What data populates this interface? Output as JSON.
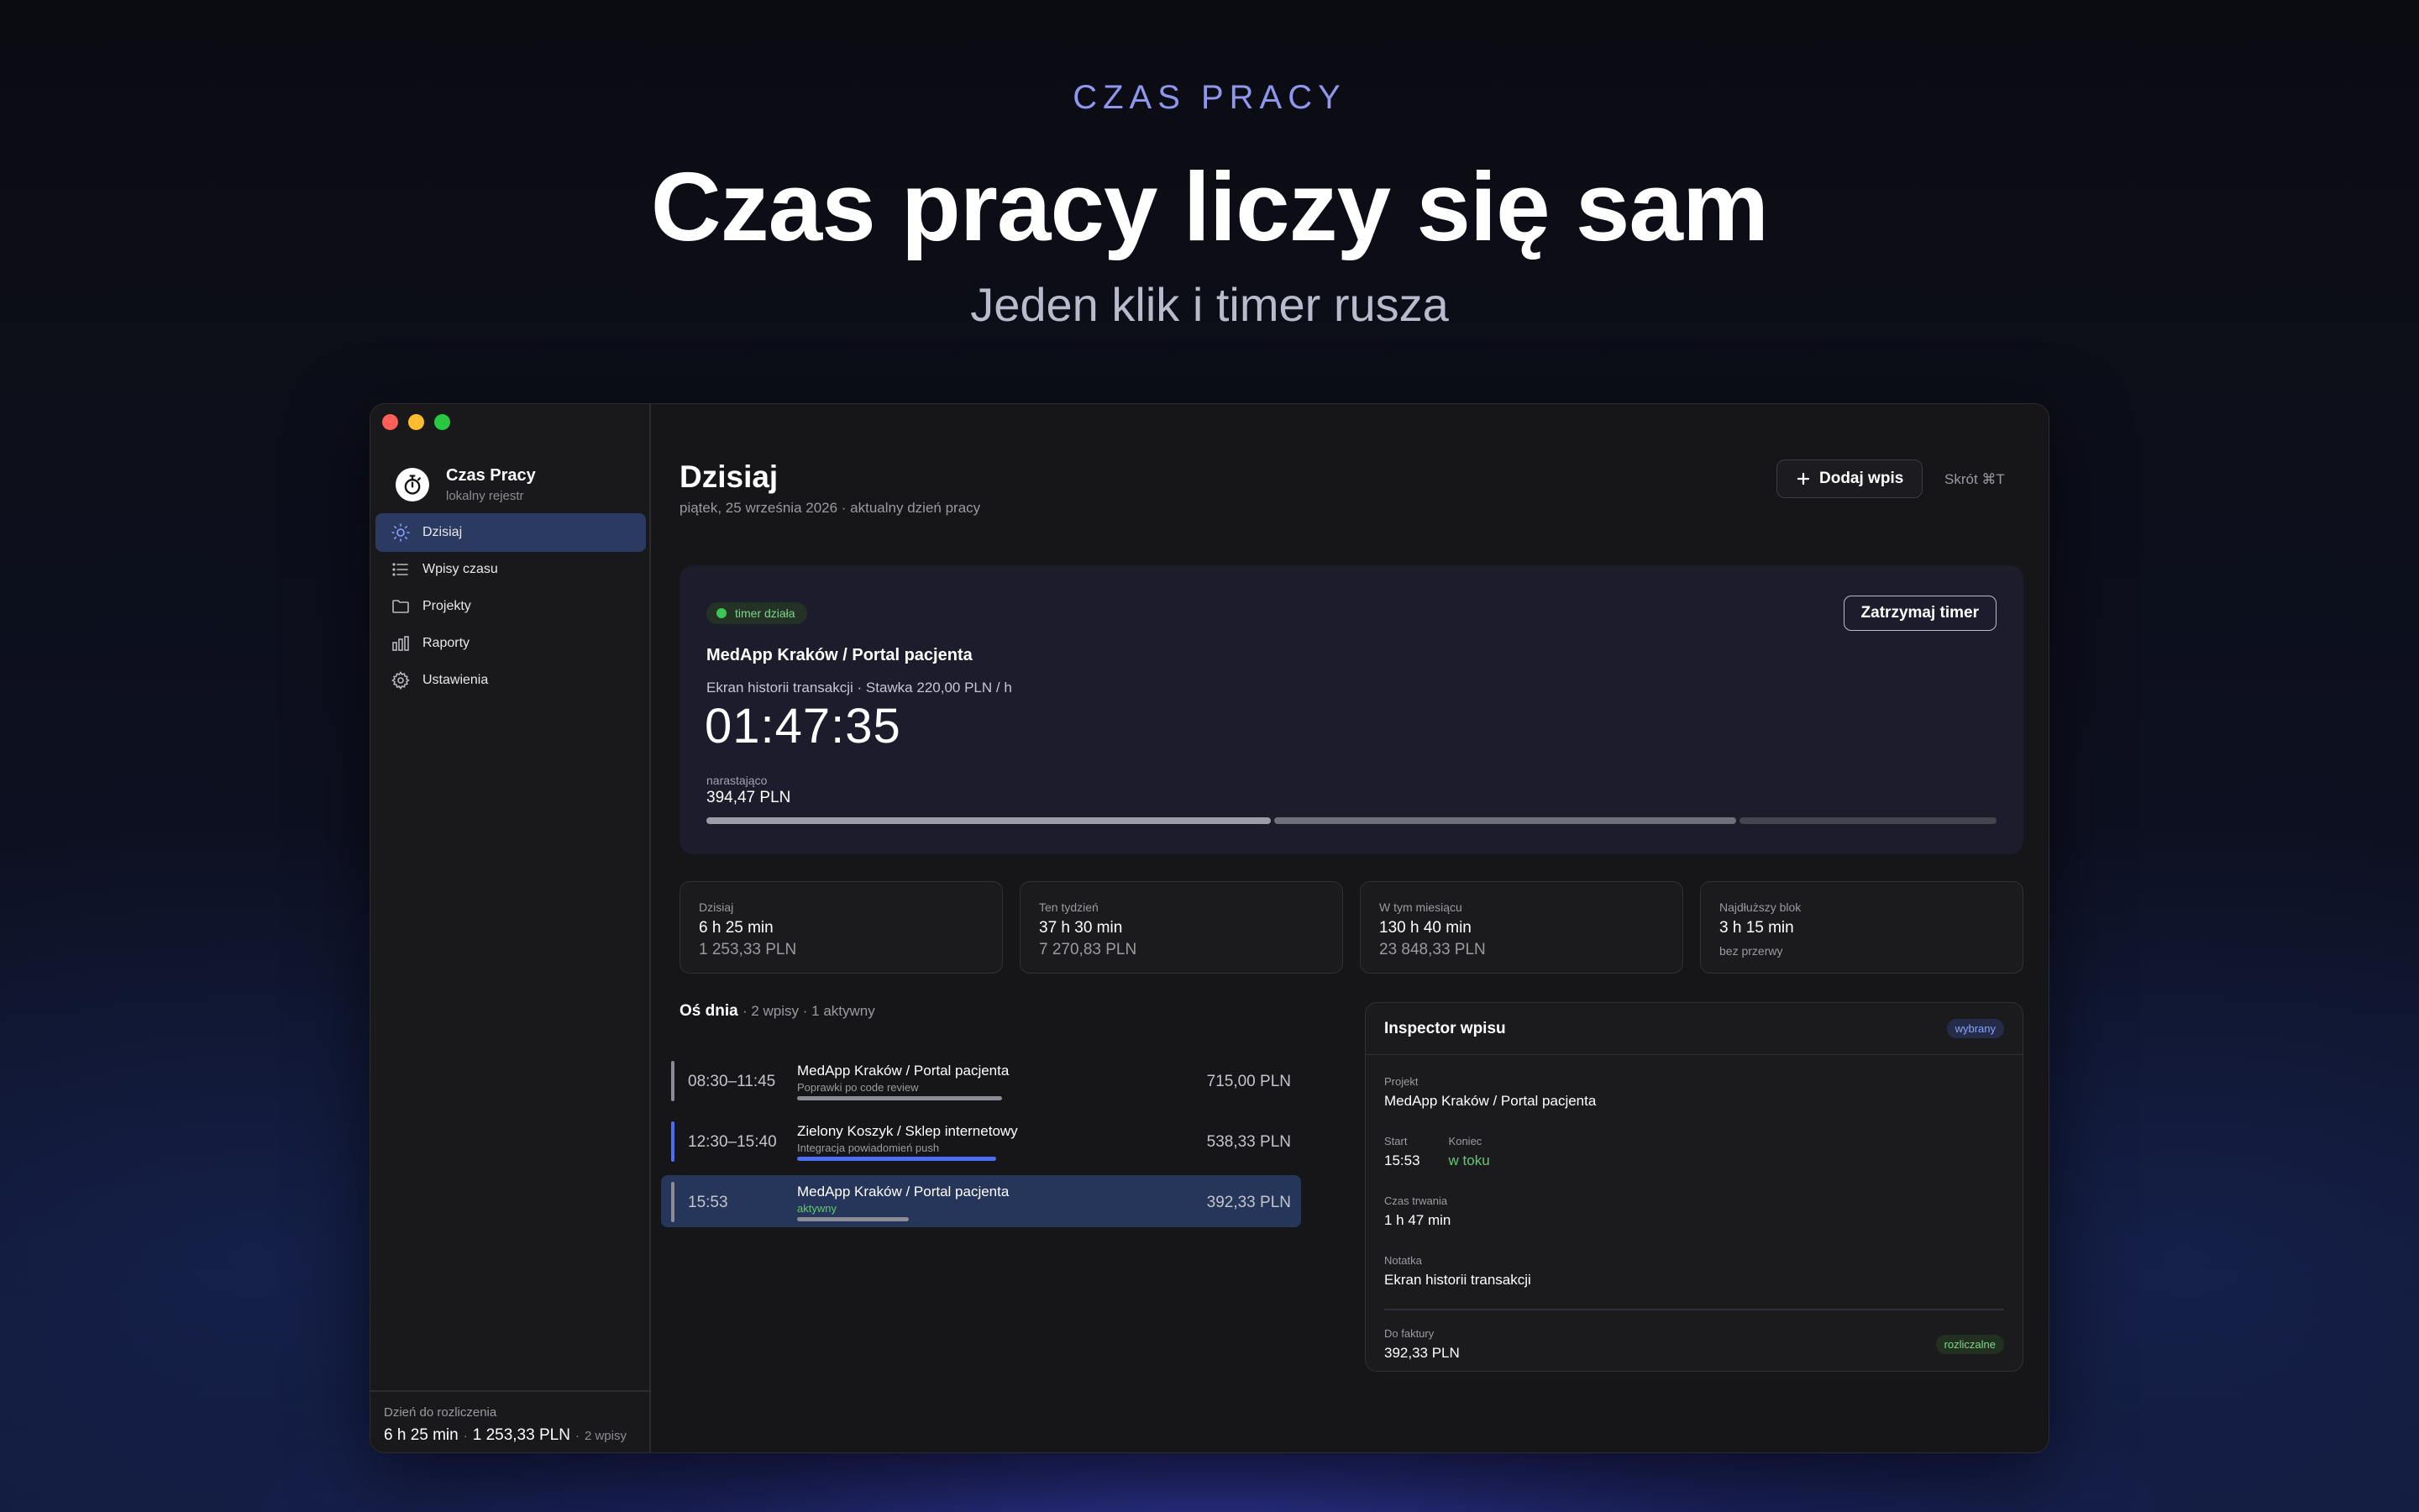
{
  "hero": {
    "eyebrow": "CZAS PRACY",
    "headline": "Czas pracy liczy się sam",
    "subheadline": "Jeden klik i timer rusza"
  },
  "colors": {
    "accent": "#8f96ee",
    "active_nav": "#2b3a60",
    "running": "#3cc655",
    "blue": "#4c6ef5"
  },
  "sidebar": {
    "app_name": "Czas Pracy",
    "app_sub": "lokalny rejestr",
    "items": [
      {
        "label": "Dzisiaj",
        "icon": "sun-icon",
        "active": true
      },
      {
        "label": "Wpisy czasu",
        "icon": "list-icon",
        "active": false
      },
      {
        "label": "Projekty",
        "icon": "folder-icon",
        "active": false
      },
      {
        "label": "Raporty",
        "icon": "bar-chart-icon",
        "active": false
      },
      {
        "label": "Ustawienia",
        "icon": "gear-icon",
        "active": false
      }
    ],
    "footer": {
      "label": "Dzień do rozliczenia",
      "hours": "6 h 25 min",
      "sep": "·",
      "amount": "1 253,33 PLN",
      "count": "2 wpisy"
    }
  },
  "main": {
    "title": "Dzisiaj",
    "subtitle": "piątek, 25 września 2026 · aktualny dzień pracy",
    "add_button": "Dodaj wpis",
    "shortcut": "Skrót ⌘T"
  },
  "timer": {
    "status": "timer działa",
    "stop_button": "Zatrzymaj timer",
    "project": "MedApp Kraków / Portal pacjenta",
    "note_line": "Ekran historii transakcji · Stawka 220,00 PLN / h",
    "elapsed": "01:47:35",
    "accrued_label": "narastająco",
    "accrued_value": "394,47 PLN",
    "segments": [
      {
        "fraction": 0.44,
        "color": "#9b9ca5"
      },
      {
        "fraction": 0.36,
        "color": "#6e6f78"
      },
      {
        "fraction": 0.2,
        "color": "#44454d"
      }
    ]
  },
  "stats": [
    {
      "label": "Dzisiaj",
      "v1": "6 h 25 min",
      "v2": "1 253,33 PLN"
    },
    {
      "label": "Ten tydzień",
      "v1": "37 h 30 min",
      "v2": "7 270,83 PLN"
    },
    {
      "label": "W tym miesiącu",
      "v1": "130 h 40 min",
      "v2": "23 848,33 PLN"
    },
    {
      "label": "Najdłuższy blok",
      "v1": "3 h 15 min",
      "v2": "bez przerwy"
    }
  ],
  "timeline": {
    "title": "Oś dnia",
    "meta": "· 2 wpisy · 1 aktywny",
    "rows": [
      {
        "time": "08:30–11:45",
        "project": "MedApp Kraków / Portal pacjenta",
        "note": "Poprawki po code review",
        "amount": "715,00 PLN",
        "rail": "#8b8c95",
        "progress": 0.66,
        "progress_color": "#8b8c95",
        "selected": false,
        "active": false
      },
      {
        "time": "12:30–15:40",
        "project": "Zielony Koszyk / Sklep internetowy",
        "note": "Integracja powiadomień push",
        "amount": "538,33 PLN",
        "rail": "#4c6ef5",
        "progress": 0.64,
        "progress_color": "#4c6ef5",
        "selected": false,
        "active": false
      },
      {
        "time": "15:53",
        "project": "MedApp Kraków / Portal pacjenta",
        "note": "aktywny",
        "amount": "392,33 PLN",
        "rail": "#8b8c95",
        "progress": 0.36,
        "progress_color": "#8b8c95",
        "selected": true,
        "active": true
      }
    ]
  },
  "inspector": {
    "title": "Inspector wpisu",
    "badge": "wybrany",
    "project_label": "Projekt",
    "project_value": "MedApp Kraków / Portal pacjenta",
    "start_label": "Start",
    "start_value": "15:53",
    "end_label": "Koniec",
    "end_value": "w toku",
    "duration_label": "Czas trwania",
    "duration_value": "1 h 47 min",
    "note_label": "Notatka",
    "note_value": "Ekran historii transakcji",
    "invoice_label": "Do faktury",
    "invoice_value": "392,33 PLN",
    "invoice_badge": "rozliczalne"
  }
}
